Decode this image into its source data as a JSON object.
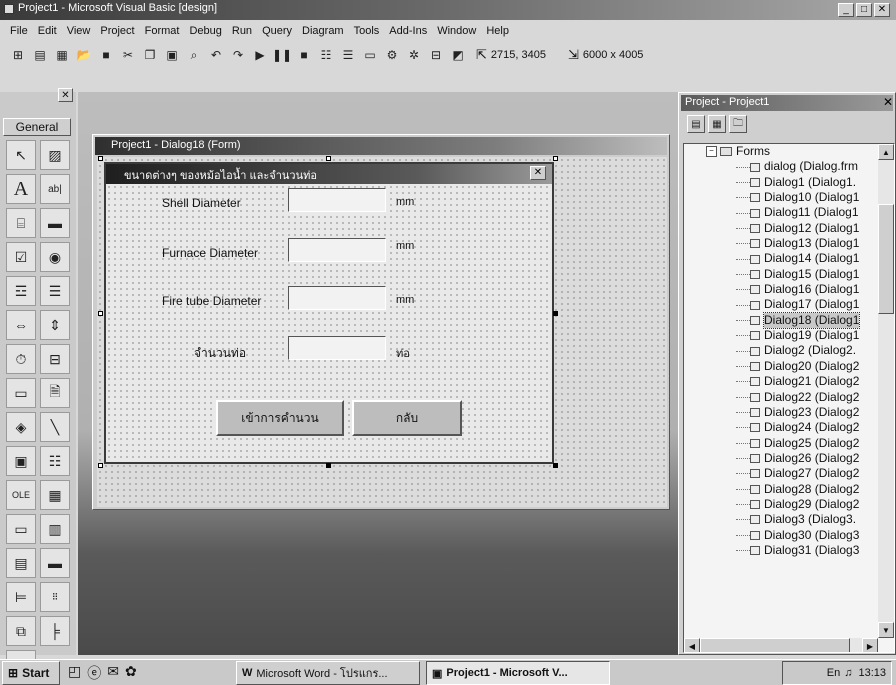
{
  "app": {
    "title": "Project1 - Microsoft Visual Basic [design]",
    "menu": [
      "File",
      "Edit",
      "View",
      "Project",
      "Format",
      "Debug",
      "Run",
      "Query",
      "Diagram",
      "Tools",
      "Add-Ins",
      "Window",
      "Help"
    ],
    "position": "2715, 3405",
    "size": "6000 x 4005"
  },
  "toolbox": {
    "title": "General",
    "tools": [
      "pointer-tool",
      "picture-tool",
      "label-tool",
      "textbox-tool",
      "frame-tool",
      "command-button-tool",
      "checkbox-tool",
      "option-button-tool",
      "combobox-tool",
      "listbox-tool",
      "hscroll-tool",
      "vscroll-tool",
      "timer-tool",
      "drive-list-tool",
      "dir-list-tool",
      "file-list-tool",
      "shape-tool",
      "line-tool",
      "image-tool",
      "data-tool",
      "ole-tool",
      "datagrid-tool",
      "dbcombo-tool",
      "dblist-tool",
      "flexgrid-tool",
      "richtext-tool",
      "common-dialog-tool",
      "toolbar-tool",
      "tabstrip-tool",
      "treeview-tool",
      "grid-tool"
    ]
  },
  "form_window": {
    "title": "Project1 - Dialog18 (Form)"
  },
  "dialog": {
    "caption": "ขนาดต่างๆ ของหม้อไอน้ำ และจำนวนท่อ",
    "fields": [
      {
        "label": "Shell Diameter",
        "value": "",
        "unit": "mm"
      },
      {
        "label": "Furnace Diameter",
        "value": "",
        "unit": "mm"
      },
      {
        "label": "Fire tube Diameter",
        "value": "",
        "unit": "mm"
      },
      {
        "label": "จำนวนท่อ",
        "value": "",
        "unit": "ท่อ"
      }
    ],
    "buttons": {
      "calculate": "เข้าการคำนวน",
      "back": "กลับ"
    }
  },
  "project_explorer": {
    "title": "Project - Project1",
    "folder": "Forms",
    "items": [
      "dialog (Dialog.frm",
      "Dialog1 (Dialog1.",
      "Dialog10 (Dialog1",
      "Dialog11 (Dialog1",
      "Dialog12 (Dialog1",
      "Dialog13 (Dialog1",
      "Dialog14 (Dialog1",
      "Dialog15 (Dialog1",
      "Dialog16 (Dialog1",
      "Dialog17 (Dialog1",
      "Dialog18 (Dialog1",
      "Dialog19 (Dialog1",
      "Dialog2 (Dialog2.",
      "Dialog20 (Dialog2",
      "Dialog21 (Dialog2",
      "Dialog22 (Dialog2",
      "Dialog23 (Dialog2",
      "Dialog24 (Dialog2",
      "Dialog25 (Dialog2",
      "Dialog26 (Dialog2",
      "Dialog27 (Dialog2",
      "Dialog28 (Dialog2",
      "Dialog29 (Dialog2",
      "Dialog3 (Dialog3.",
      "Dialog30 (Dialog3",
      "Dialog31 (Dialog3"
    ],
    "selected_index": 10
  },
  "taskbar": {
    "start": "Start",
    "tasks": [
      "Microsoft Word - โปรแกร...",
      "Project1 - Microsoft V..."
    ],
    "clock": "13:13"
  }
}
